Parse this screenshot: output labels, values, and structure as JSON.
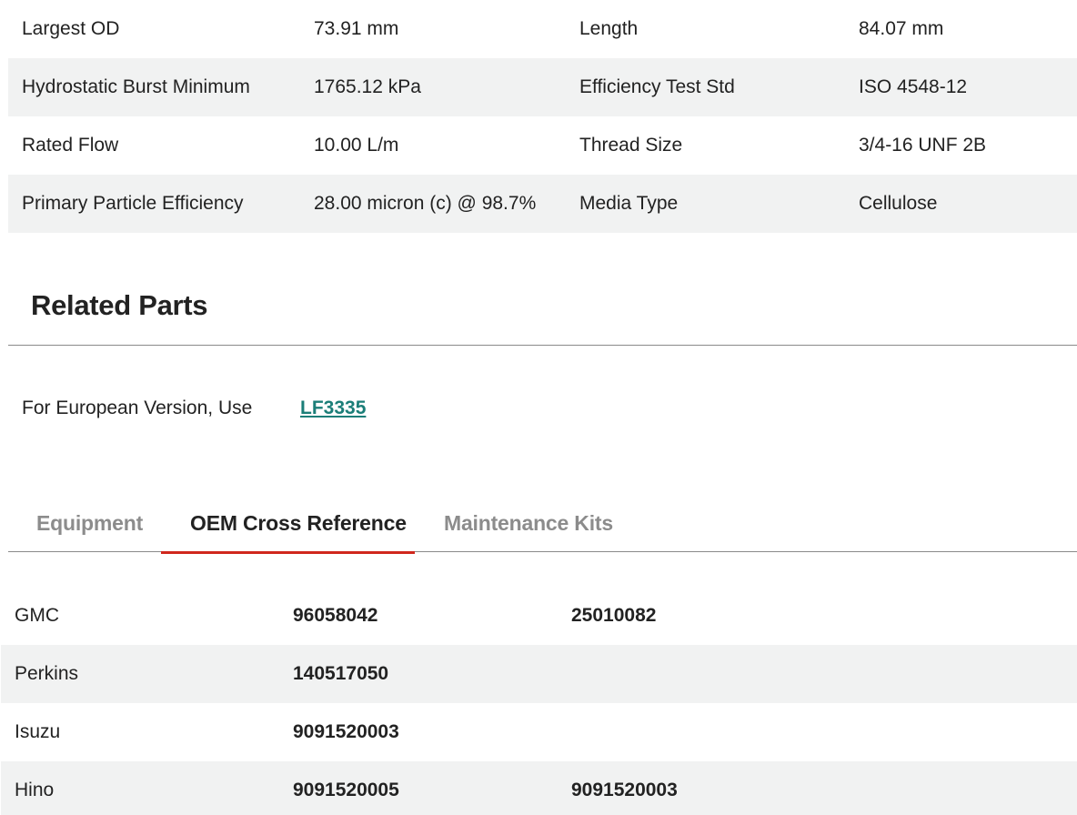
{
  "specs": [
    {
      "label1": "Largest OD",
      "value1": "73.91 mm",
      "label2": "Length",
      "value2": "84.07 mm"
    },
    {
      "label1": "Hydrostatic Burst Minimum",
      "value1": "1765.12 kPa",
      "label2": "Efficiency Test Std",
      "value2": "ISO 4548-12"
    },
    {
      "label1": "Rated Flow",
      "value1": "10.00 L/m",
      "label2": "Thread Size",
      "value2": "3/4-16 UNF 2B"
    },
    {
      "label1": "Primary Particle Efficiency",
      "value1": "28.00 micron (c) @ 98.7%",
      "label2": "Media Type",
      "value2": "Cellulose"
    }
  ],
  "related": {
    "title": "Related Parts",
    "label": "For European Version, Use",
    "link": "LF3335"
  },
  "tabs": [
    {
      "label": "Equipment",
      "active": false
    },
    {
      "label": "OEM Cross Reference",
      "active": true
    },
    {
      "label": "Maintenance Kits",
      "active": false
    }
  ],
  "oem": [
    {
      "brand": "GMC",
      "part1": "96058042",
      "part2": "25010082"
    },
    {
      "brand": "Perkins",
      "part1": "140517050",
      "part2": ""
    },
    {
      "brand": "Isuzu",
      "part1": "9091520003",
      "part2": ""
    },
    {
      "brand": "Hino",
      "part1": "9091520005",
      "part2": "9091520003"
    }
  ],
  "colors": {
    "accent": "#d0271d",
    "link": "#1b7e78",
    "row_shade": "#f1f2f2"
  }
}
